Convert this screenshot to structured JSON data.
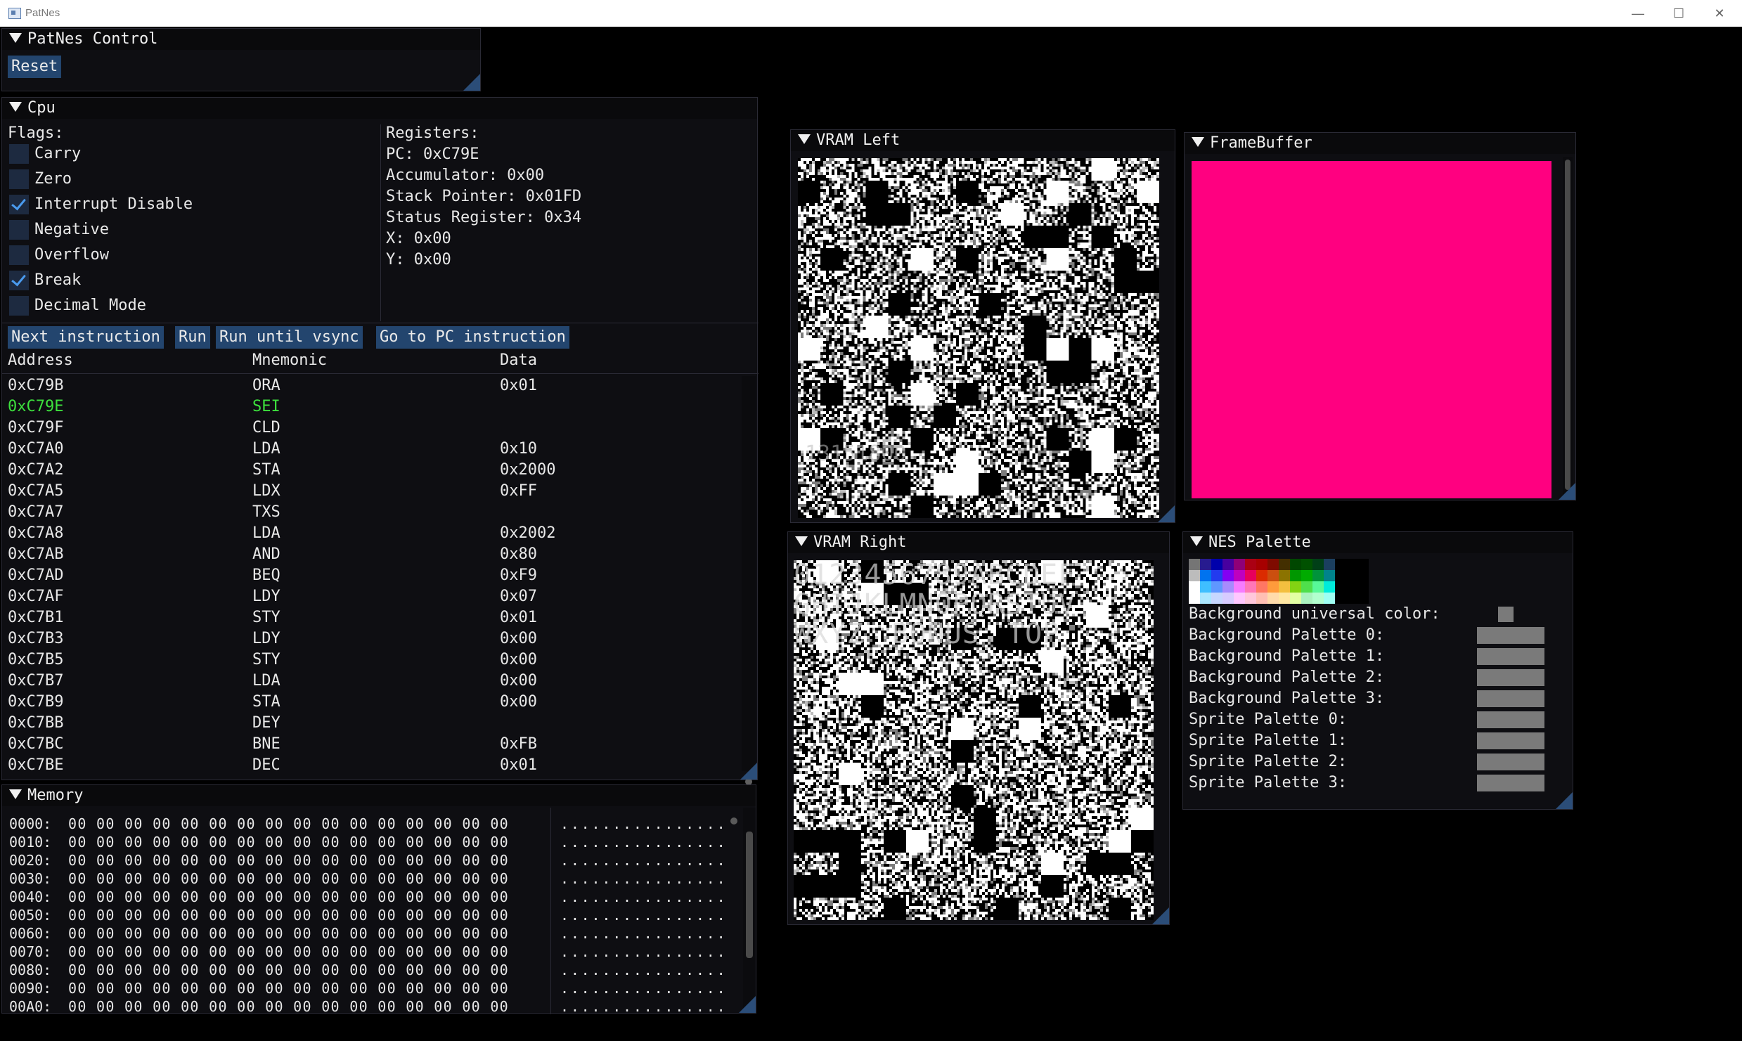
{
  "window": {
    "title": "PatNes",
    "minimize_glyph": "—",
    "maximize_glyph": "☐",
    "close_glyph": "✕"
  },
  "control": {
    "title": "PatNes Control",
    "reset_label": "Reset"
  },
  "cpu": {
    "title": "Cpu",
    "flags_label": "Flags:",
    "flags": [
      {
        "label": "Carry",
        "checked": false
      },
      {
        "label": "Zero",
        "checked": false
      },
      {
        "label": "Interrupt Disable",
        "checked": true
      },
      {
        "label": "Negative",
        "checked": false
      },
      {
        "label": "Overflow",
        "checked": false
      },
      {
        "label": "Break",
        "checked": true
      },
      {
        "label": "Decimal Mode",
        "checked": false
      }
    ],
    "registers_label": "Registers:",
    "registers": [
      "PC: 0xC79E",
      "Accumulator: 0x00",
      "Stack Pointer: 0x01FD",
      "Status Register: 0x34",
      "X: 0x00",
      "Y: 0x00"
    ],
    "buttons": {
      "next": "Next instruction",
      "run": "Run",
      "run_vsync": "Run until vsync",
      "goto_pc": "Go to PC instruction"
    },
    "columns": [
      "Address",
      "Mnemonic",
      "Data"
    ],
    "rows": [
      {
        "address": "0xC79B",
        "mnemonic": "ORA",
        "data": "0x01",
        "current": false
      },
      {
        "address": "0xC79E",
        "mnemonic": "SEI",
        "data": "",
        "current": true
      },
      {
        "address": "0xC79F",
        "mnemonic": "CLD",
        "data": "",
        "current": false
      },
      {
        "address": "0xC7A0",
        "mnemonic": "LDA",
        "data": "0x10",
        "current": false
      },
      {
        "address": "0xC7A2",
        "mnemonic": "STA",
        "data": "0x2000",
        "current": false
      },
      {
        "address": "0xC7A5",
        "mnemonic": "LDX",
        "data": "0xFF",
        "current": false
      },
      {
        "address": "0xC7A7",
        "mnemonic": "TXS",
        "data": "",
        "current": false
      },
      {
        "address": "0xC7A8",
        "mnemonic": "LDA",
        "data": "0x2002",
        "current": false
      },
      {
        "address": "0xC7AB",
        "mnemonic": "AND",
        "data": "0x80",
        "current": false
      },
      {
        "address": "0xC7AD",
        "mnemonic": "BEQ",
        "data": "0xF9",
        "current": false
      },
      {
        "address": "0xC7AF",
        "mnemonic": "LDY",
        "data": "0x07",
        "current": false
      },
      {
        "address": "0xC7B1",
        "mnemonic": "STY",
        "data": "0x01",
        "current": false
      },
      {
        "address": "0xC7B3",
        "mnemonic": "LDY",
        "data": "0x00",
        "current": false
      },
      {
        "address": "0xC7B5",
        "mnemonic": "STY",
        "data": "0x00",
        "current": false
      },
      {
        "address": "0xC7B7",
        "mnemonic": "LDA",
        "data": "0x00",
        "current": false
      },
      {
        "address": "0xC7B9",
        "mnemonic": "STA",
        "data": "0x00",
        "current": false
      },
      {
        "address": "0xC7BB",
        "mnemonic": "DEY",
        "data": "",
        "current": false
      },
      {
        "address": "0xC7BC",
        "mnemonic": "BNE",
        "data": "0xFB",
        "current": false
      },
      {
        "address": "0xC7BE",
        "mnemonic": "DEC",
        "data": "0x01",
        "current": false
      }
    ]
  },
  "memory": {
    "title": "Memory",
    "rows": [
      {
        "address": "0000:",
        "bytes": "00 00 00 00 00 00 00 00 00 00 00 00 00 00 00 00",
        "ascii": "................"
      },
      {
        "address": "0010:",
        "bytes": "00 00 00 00 00 00 00 00 00 00 00 00 00 00 00 00",
        "ascii": "................"
      },
      {
        "address": "0020:",
        "bytes": "00 00 00 00 00 00 00 00 00 00 00 00 00 00 00 00",
        "ascii": "................"
      },
      {
        "address": "0030:",
        "bytes": "00 00 00 00 00 00 00 00 00 00 00 00 00 00 00 00",
        "ascii": "................"
      },
      {
        "address": "0040:",
        "bytes": "00 00 00 00 00 00 00 00 00 00 00 00 00 00 00 00",
        "ascii": "................"
      },
      {
        "address": "0050:",
        "bytes": "00 00 00 00 00 00 00 00 00 00 00 00 00 00 00 00",
        "ascii": "................"
      },
      {
        "address": "0060:",
        "bytes": "00 00 00 00 00 00 00 00 00 00 00 00 00 00 00 00",
        "ascii": "................"
      },
      {
        "address": "0070:",
        "bytes": "00 00 00 00 00 00 00 00 00 00 00 00 00 00 00 00",
        "ascii": "................"
      },
      {
        "address": "0080:",
        "bytes": "00 00 00 00 00 00 00 00 00 00 00 00 00 00 00 00",
        "ascii": "................"
      },
      {
        "address": "0090:",
        "bytes": "00 00 00 00 00 00 00 00 00 00 00 00 00 00 00 00",
        "ascii": "................"
      },
      {
        "address": "00A0:",
        "bytes": "00 00 00 00 00 00 00 00 00 00 00 00 00 00 00 00",
        "ascii": "................"
      }
    ]
  },
  "vram_left": {
    "title": "VRAM Left",
    "visible_text": "13151800"
  },
  "vram_right": {
    "title": "VRAM Right",
    "visible_text": "0123456789ABCDEF GHIJKLMNOPQRSTUV WXYZ BONUS TOP"
  },
  "framebuffer": {
    "title": "FrameBuffer",
    "fill_color": "#ff0080"
  },
  "nes_palette": {
    "title": "NES Palette",
    "universal_label": "Background universal color:",
    "palettes": [
      "Background Palette 0:",
      "Background Palette 1:",
      "Background Palette 2:",
      "Background Palette 3:",
      "Sprite Palette 0:",
      "Sprite Palette 1:",
      "Sprite Palette 2:",
      "Sprite Palette 3:"
    ],
    "swatch_color": "#7a7a7a",
    "colors": [
      [
        "#757575",
        "#271b8f",
        "#0000ab",
        "#47009f",
        "#8f0077",
        "#ab0013",
        "#a70000",
        "#7f0b00",
        "#432f00",
        "#004700",
        "#005100",
        "#003f17",
        "#1b3f5f",
        "#000000",
        "#000000",
        "#000000"
      ],
      [
        "#bcbcbc",
        "#0073ef",
        "#233bef",
        "#8300f3",
        "#bf00bf",
        "#e7005b",
        "#db2b00",
        "#cb4f0f",
        "#8b7300",
        "#009700",
        "#00ab00",
        "#00933b",
        "#00838b",
        "#000000",
        "#000000",
        "#000000"
      ],
      [
        "#ffffff",
        "#3fbfff",
        "#5f97ff",
        "#a78bfd",
        "#f77bff",
        "#ff77b7",
        "#ff7763",
        "#ff9b3b",
        "#f3bf3f",
        "#83d313",
        "#4fdf4b",
        "#58f898",
        "#00ebdb",
        "#000000",
        "#000000",
        "#000000"
      ],
      [
        "#ffffff",
        "#abe7ff",
        "#c7d7ff",
        "#d7cbff",
        "#ffc7ff",
        "#ffc7db",
        "#ffbfb3",
        "#ffdbab",
        "#ffe7a3",
        "#e3ffa3",
        "#abf3bf",
        "#b3ffcf",
        "#9ffff3",
        "#000000",
        "#000000",
        "#000000"
      ]
    ]
  }
}
